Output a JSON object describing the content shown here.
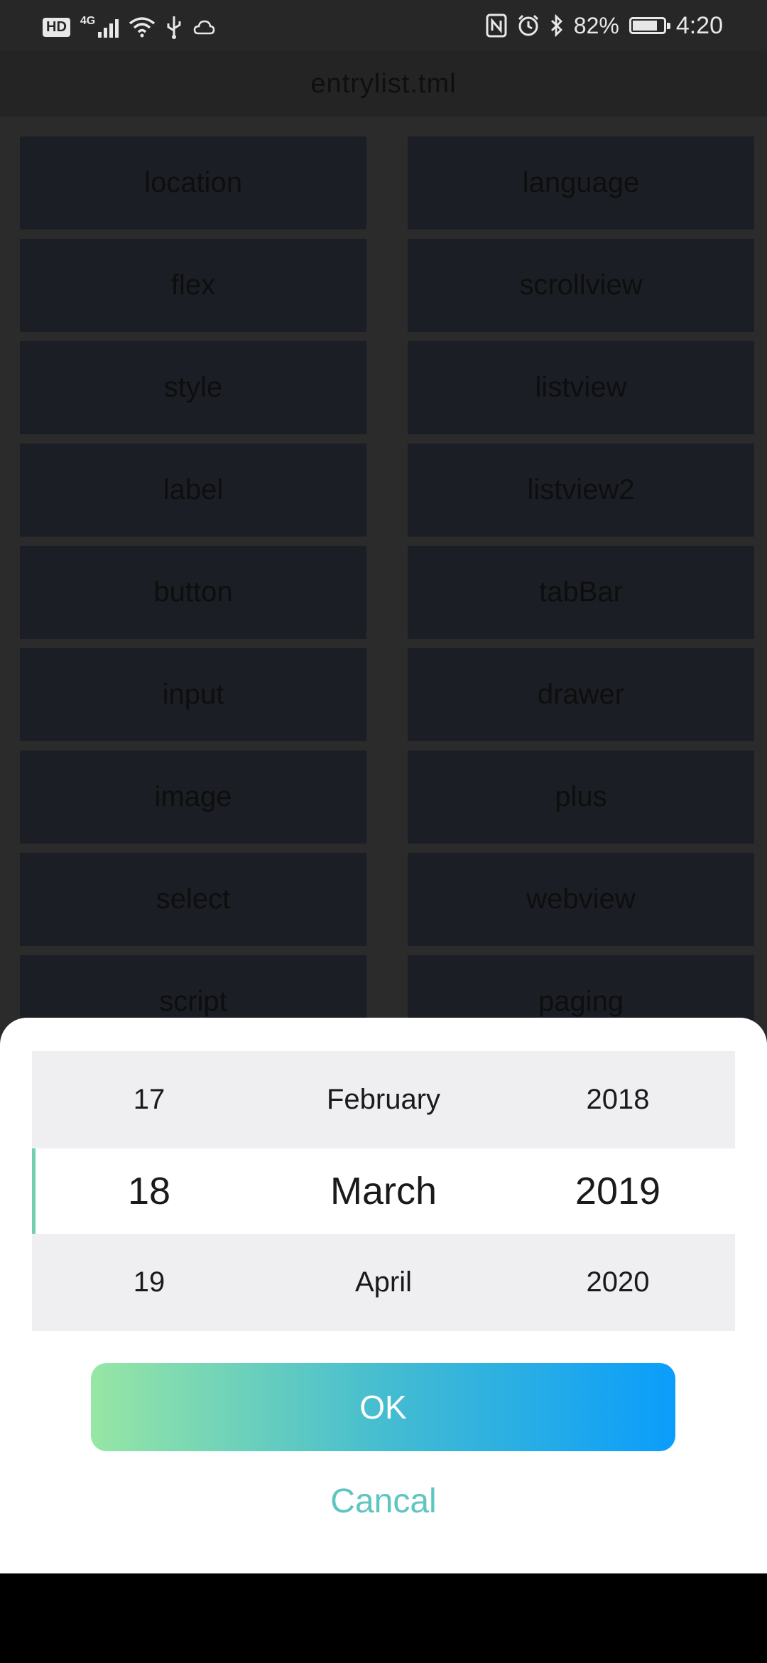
{
  "status_bar": {
    "hd": "HD",
    "network": "4G",
    "battery_percent": "82%",
    "time": "4:20",
    "battery_level": 0.82,
    "icons": [
      "hd-icon",
      "signal-icon",
      "wifi-icon",
      "usb-icon",
      "cloud-icon",
      "nfc-icon",
      "alarm-icon",
      "bluetooth-icon",
      "battery-icon"
    ]
  },
  "app": {
    "title": "entrylist.tml"
  },
  "entries": [
    "location",
    "language",
    "flex",
    "scrollview",
    "style",
    "listview",
    "label",
    "listview2",
    "button",
    "tabBar",
    "input",
    "drawer",
    "image",
    "plus",
    "select",
    "webview",
    "script",
    "paging"
  ],
  "date_picker": {
    "above": {
      "day": "17",
      "month": "February",
      "year": "2018"
    },
    "selected": {
      "day": "18",
      "month": "March",
      "year": "2019"
    },
    "below": {
      "day": "19",
      "month": "April",
      "year": "2020"
    }
  },
  "actions": {
    "ok_label": "OK",
    "cancel_label": "Cancal"
  },
  "colors": {
    "ok_gradient_start": "#97e6a4",
    "ok_gradient_end": "#0a9dfb",
    "cancel_text": "#5fc5c0",
    "selection_marker": "#6fcfb0"
  }
}
